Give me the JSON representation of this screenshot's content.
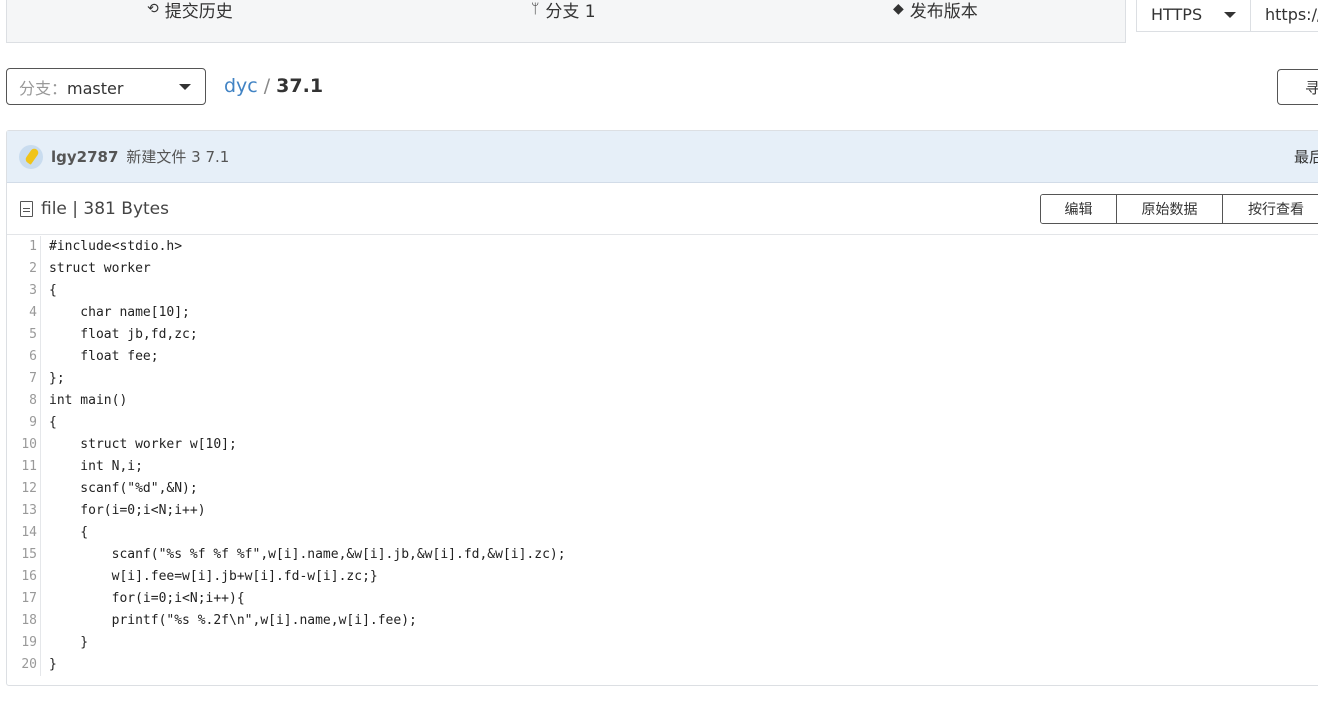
{
  "stats": {
    "commits_label": "提交历史",
    "branches_label": "分支 1",
    "releases_label": "发布版本"
  },
  "clone": {
    "protocol": "HTTPS",
    "url": "https://"
  },
  "branch": {
    "label": "分支：",
    "value": "master"
  },
  "breadcrumb": {
    "repo": "dyc",
    "separator": "/",
    "file": "37.1"
  },
  "find_button": {
    "label": "寻"
  },
  "commit": {
    "user": "lgy2787",
    "message": "新建文件 3 7.1",
    "latest": "最后"
  },
  "file": {
    "info": "file | 381 Bytes",
    "edit_label": "编辑",
    "raw_label": "原始数据",
    "blame_label": "按行查看"
  },
  "code": {
    "lines": [
      "#include<stdio.h>",
      "struct worker",
      "{",
      "    char name[10];",
      "    float jb,fd,zc;",
      "    float fee;",
      "};",
      "int main()",
      "{",
      "    struct worker w[10];",
      "    int N,i;",
      "    scanf(\"%d\",&N);",
      "    for(i=0;i<N;i++)",
      "    {",
      "        scanf(\"%s %f %f %f\",w[i].name,&w[i].jb,&w[i].fd,&w[i].zc);",
      "        w[i].fee=w[i].jb+w[i].fd-w[i].zc;}",
      "        for(i=0;i<N;i++){",
      "        printf(\"%s %.2f\\n\",w[i].name,w[i].fee);",
      "    }",
      "}"
    ]
  }
}
